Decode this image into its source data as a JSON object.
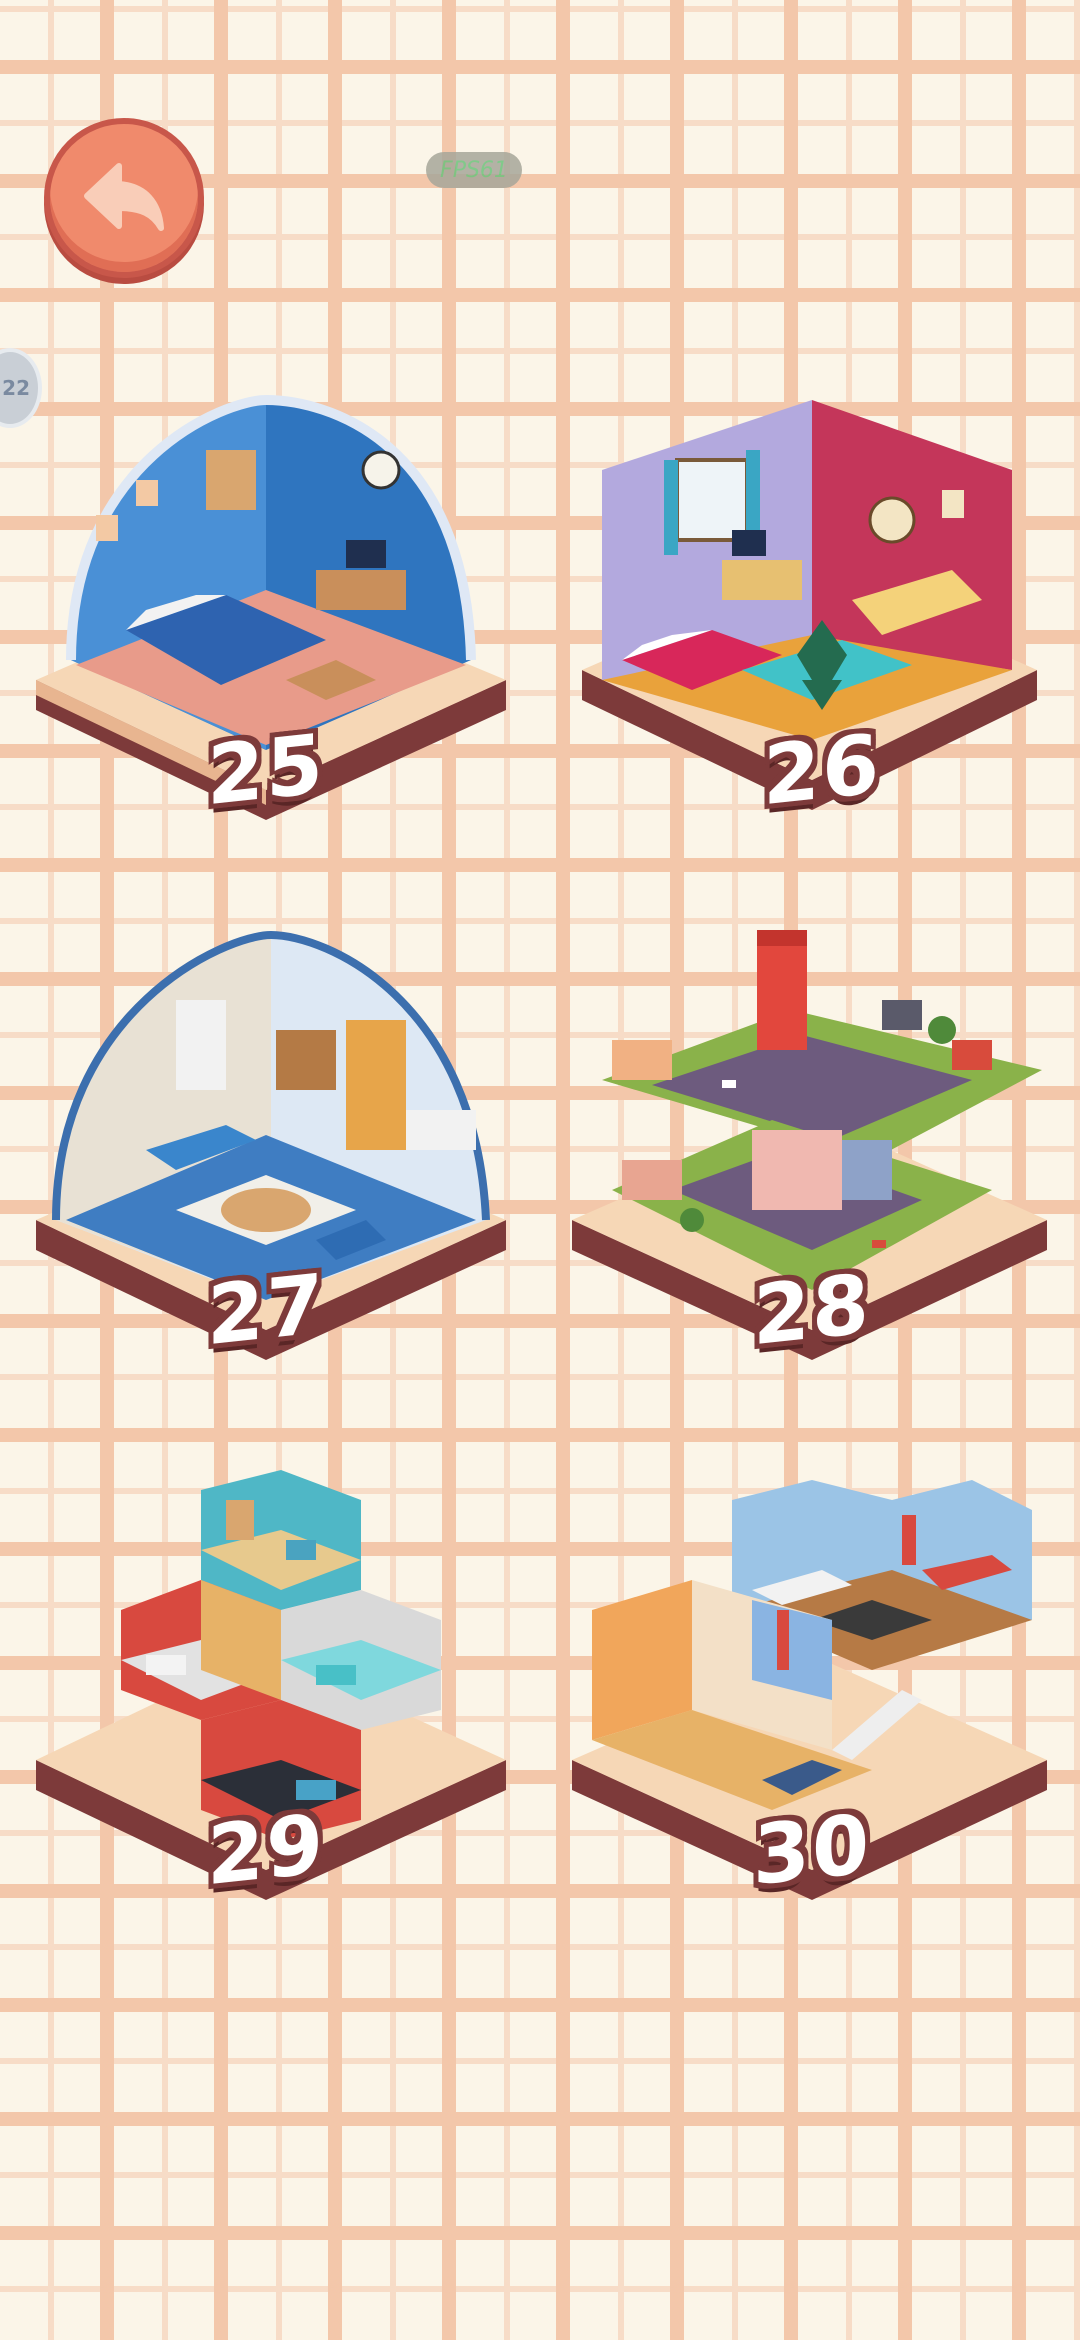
{
  "hud": {
    "fps_label": "FPS61",
    "side_badge": "22"
  },
  "levels": [
    {
      "number": "25",
      "theme": "blue bedroom",
      "color": "#2f75bf"
    },
    {
      "number": "26",
      "theme": "purple and pink bedroom",
      "color": "#c4365a"
    },
    {
      "number": "27",
      "theme": "blue living room",
      "color": "#3f7dc2"
    },
    {
      "number": "28",
      "theme": "city block",
      "color": "#8ab24a"
    },
    {
      "number": "29",
      "theme": "hexagon apartment",
      "color": "#4fb7c6"
    },
    {
      "number": "30",
      "theme": "two-floor house",
      "color": "#d86a45"
    }
  ],
  "colors": {
    "background": "#fbf5e8",
    "grid_line": "#f3c7aa",
    "back_button": "#f08a6c",
    "platform_top": "#f6d7b6",
    "platform_side": "#7d3a3a"
  }
}
